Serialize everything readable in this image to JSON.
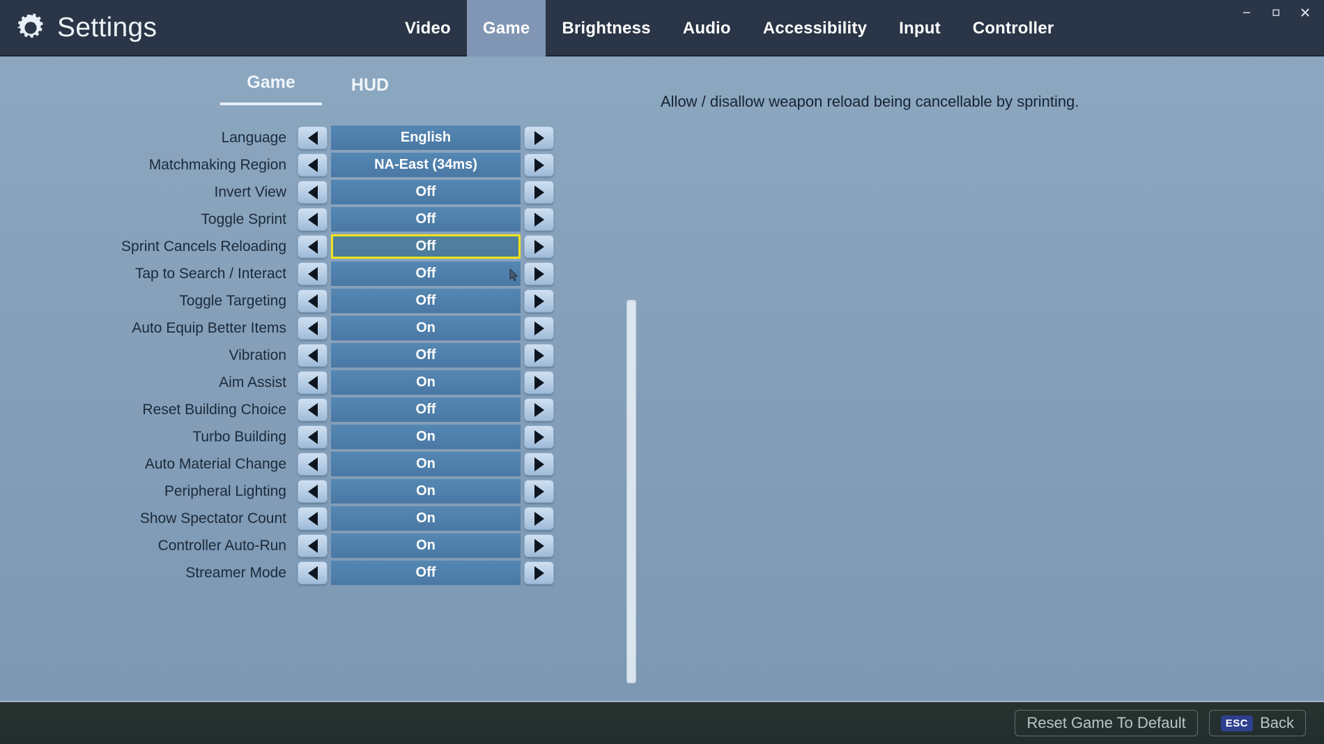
{
  "window": {
    "minimize_label": "minimize",
    "maximize_label": "maximize",
    "close_label": "close"
  },
  "header": {
    "icon": "gear-icon",
    "title": "Settings",
    "tabs": [
      {
        "label": "Video",
        "active": false
      },
      {
        "label": "Game",
        "active": true
      },
      {
        "label": "Brightness",
        "active": false
      },
      {
        "label": "Audio",
        "active": false
      },
      {
        "label": "Accessibility",
        "active": false
      },
      {
        "label": "Input",
        "active": false
      },
      {
        "label": "Controller",
        "active": false
      }
    ]
  },
  "subtabs": [
    {
      "label": "Game",
      "active": true
    },
    {
      "label": "HUD",
      "active": false
    }
  ],
  "settings": [
    {
      "label": "Language",
      "value": "English",
      "selected": false
    },
    {
      "label": "Matchmaking Region",
      "value": "NA-East (34ms)",
      "selected": false
    },
    {
      "label": "Invert View",
      "value": "Off",
      "selected": false
    },
    {
      "label": "Toggle Sprint",
      "value": "Off",
      "selected": false
    },
    {
      "label": "Sprint Cancels Reloading",
      "value": "Off",
      "selected": true
    },
    {
      "label": "Tap to Search / Interact",
      "value": "Off",
      "selected": false
    },
    {
      "label": "Toggle Targeting",
      "value": "Off",
      "selected": false
    },
    {
      "label": "Auto Equip Better Items",
      "value": "On",
      "selected": false
    },
    {
      "label": "Vibration",
      "value": "Off",
      "selected": false
    },
    {
      "label": "Aim Assist",
      "value": "On",
      "selected": false
    },
    {
      "label": "Reset Building Choice",
      "value": "Off",
      "selected": false
    },
    {
      "label": "Turbo Building",
      "value": "On",
      "selected": false
    },
    {
      "label": "Auto Material Change",
      "value": "On",
      "selected": false
    },
    {
      "label": "Peripheral Lighting",
      "value": "On",
      "selected": false
    },
    {
      "label": "Show Spectator Count",
      "value": "On",
      "selected": false
    },
    {
      "label": "Controller Auto-Run",
      "value": "On",
      "selected": false
    },
    {
      "label": "Streamer Mode",
      "value": "Off",
      "selected": false
    }
  ],
  "description": "Allow / disallow weapon reload being cancellable by sprinting.",
  "bottom_bar": {
    "reset_label": "Reset Game To Default",
    "back_key": "ESC",
    "back_label": "Back"
  },
  "colors": {
    "accent_highlight": "#f2e31c",
    "pill": "#4f7fab",
    "titlebar": "#2a3547",
    "active_tab": "#8096b4",
    "esc_key": "#2f3f8e"
  }
}
